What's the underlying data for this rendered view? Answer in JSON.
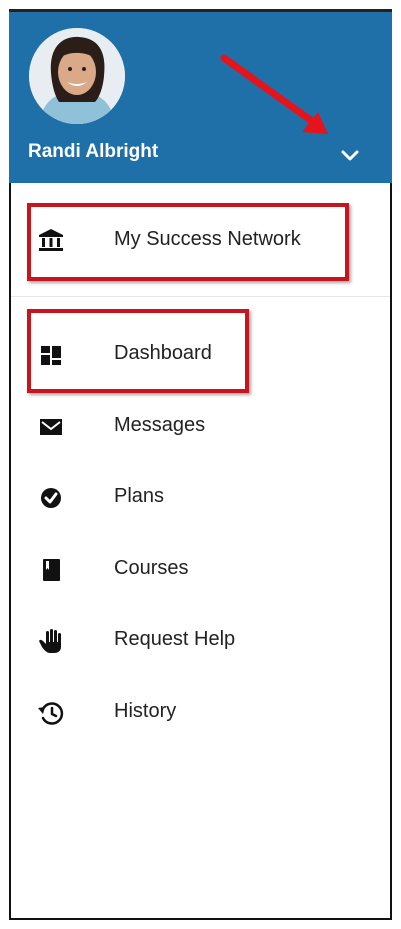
{
  "user": {
    "name": "Randi Albright"
  },
  "featured": {
    "label": "My Success Network",
    "icon": "institution-icon"
  },
  "nav": {
    "items": [
      {
        "label": "Dashboard",
        "icon": "dashboard-icon"
      },
      {
        "label": "Messages",
        "icon": "envelope-icon"
      },
      {
        "label": "Plans",
        "icon": "check-circle-icon"
      },
      {
        "label": "Courses",
        "icon": "book-icon"
      },
      {
        "label": "Request Help",
        "icon": "raised-hand-icon"
      },
      {
        "label": "History",
        "icon": "history-icon"
      }
    ]
  },
  "colors": {
    "header": "#1f6fa8",
    "highlight": "#c8141e",
    "arrow": "#e3141c"
  }
}
